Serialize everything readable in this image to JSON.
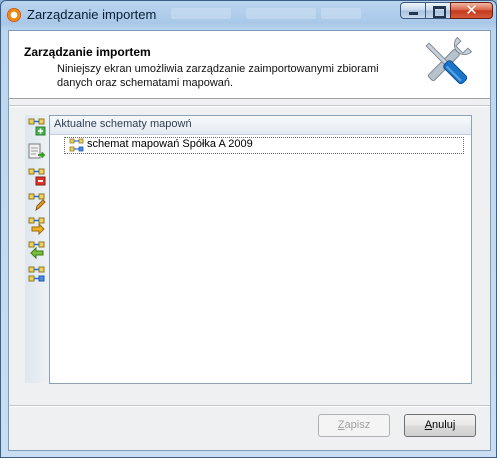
{
  "window": {
    "title": "Zarządzanie importem",
    "controls": {
      "minimize": "–",
      "maximize": "□",
      "close": "✕"
    }
  },
  "header": {
    "title": "Zarządzanie importem",
    "description": "Niniejszy ekran umożliwia zarządzanie zaimportowanymi zbiorami danych oraz schematami mapowań.",
    "icon": "tools-icon"
  },
  "toolbar": {
    "items": [
      {
        "icon": "add-schema-icon"
      },
      {
        "icon": "import-schema-icon"
      },
      {
        "icon": "delete-schema-icon"
      },
      {
        "icon": "edit-schema-icon"
      },
      {
        "icon": "move-right-icon"
      },
      {
        "icon": "move-left-icon"
      },
      {
        "icon": "schema-properties-icon"
      }
    ]
  },
  "tree": {
    "header": "Aktualne schematy mapowń",
    "items": [
      {
        "label": "schemat mapowań Spółka A 2009",
        "icon": "schema-icon"
      }
    ]
  },
  "buttons": {
    "save": {
      "label_first": "Z",
      "label_rest": "apisz",
      "enabled": false
    },
    "cancel": {
      "label_first": "A",
      "label_rest": "nuluj",
      "enabled": true
    }
  },
  "colors": {
    "title_bar": "#a9c8e8",
    "close_button": "#c3391f",
    "accent_icon": "#1a75c8"
  }
}
